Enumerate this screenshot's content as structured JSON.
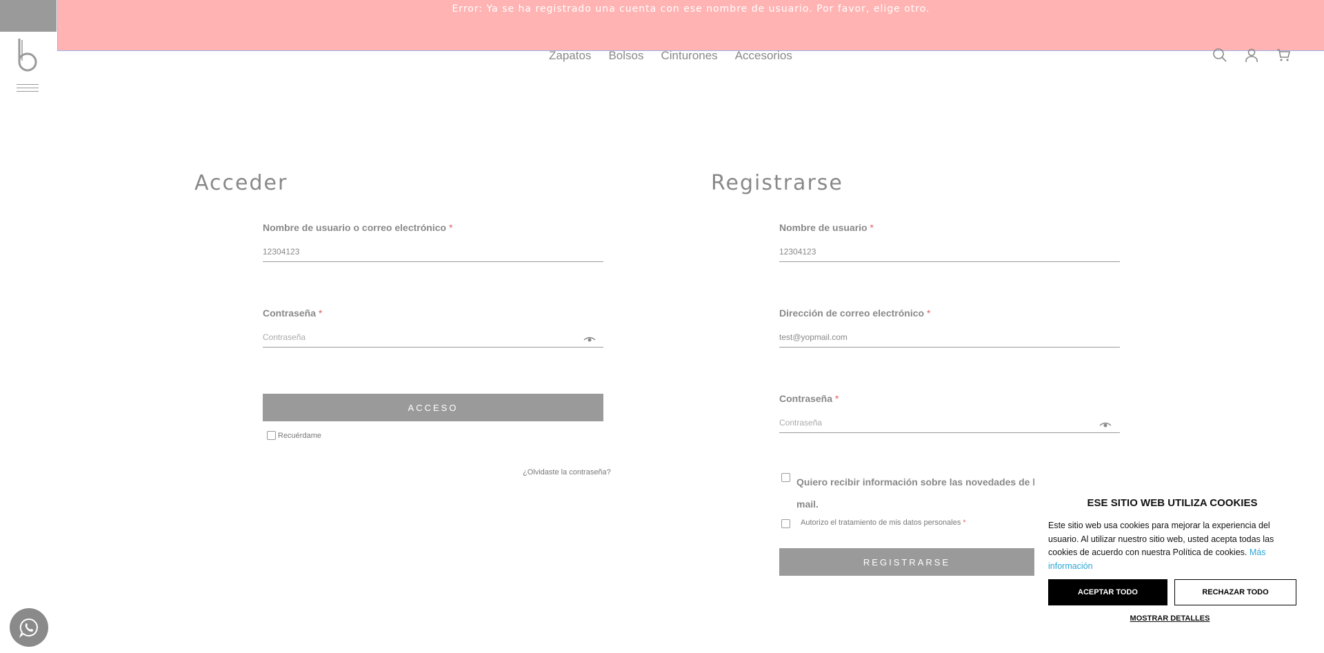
{
  "error_message": "Error: Ya se ha registrado una cuenta con ese nombre de usuario. Por favor, elige otro.",
  "nav": {
    "items": [
      "Zapatos",
      "Bolsos",
      "Cinturones",
      "Accesorios"
    ]
  },
  "header_icons": [
    "search-icon",
    "user-icon",
    "cart-icon"
  ],
  "login": {
    "title": "Acceder",
    "username_label": "Nombre de usuario o correo electrónico",
    "username_value": "12304123",
    "password_label": "Contraseña",
    "password_placeholder": "Contraseña",
    "submit_label": "ACCESO",
    "remember_label": "Recuérdame",
    "forgot_label": "¿Olvidaste la contraseña?",
    "required_mark": "*"
  },
  "register": {
    "title": "Registrarse",
    "username_label": "Nombre de usuario",
    "username_value": "12304123",
    "email_label": "Dirección de correo electrónico",
    "email_value": "test@yopmail.com",
    "password_label": "Contraseña",
    "password_placeholder": "Contraseña",
    "newsletter_label_line1": "Quiero recibir información sobre las novedades de bon",
    "newsletter_label_line2": "mail.",
    "privacy_label": "Autorizo el tratamiento de mis datos personales",
    "submit_label": "REGISTRARSE",
    "required_mark": "*"
  },
  "cookie": {
    "title": "ESE SITIO WEB UTILIZA COOKIES",
    "text": "Este sitio web usa cookies para mejorar la experiencia del usuario. Al utilizar nuestro sitio web, usted acepta todas las cookies de acuerdo con nuestra Política de cookies.",
    "more_link": "Más información",
    "accept_label": "ACEPTAR TODO",
    "reject_label": "RECHAZAR TODO",
    "details_label": "MOSTRAR DETALLES"
  },
  "colors": {
    "error_bg": "#ffb3b3",
    "button_gray": "#9a9a9a",
    "link_blue": "#2aa5d6",
    "required_red": "#e06060"
  }
}
